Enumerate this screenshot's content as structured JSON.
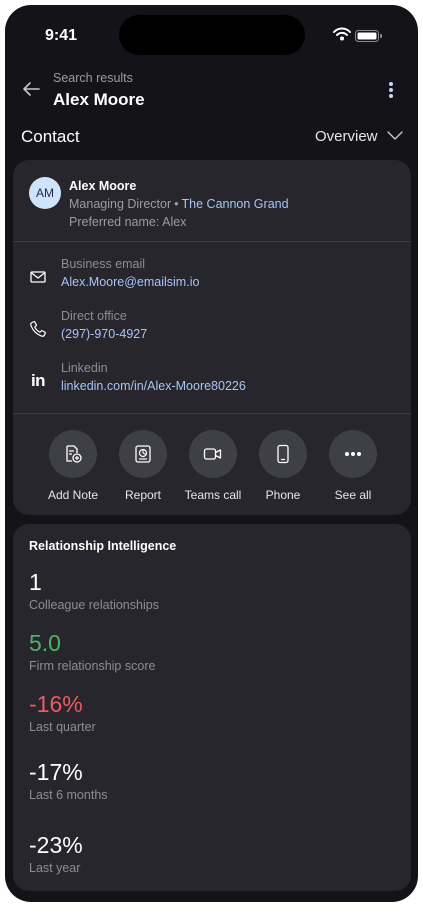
{
  "status_bar": {
    "time": "9:41"
  },
  "nav": {
    "subtitle": "Search results",
    "title": "Alex Moore"
  },
  "section": {
    "title": "Contact",
    "view_selector": "Overview"
  },
  "contact": {
    "initials": "AM",
    "name": "Alex Moore",
    "role": "Managing Director",
    "separator": "•",
    "company": "The Cannon Grand",
    "preferred_name": "Preferred name: Alex"
  },
  "details": {
    "email": {
      "label": "Business email",
      "value": "Alex.Moore@emailsim.io",
      "icon": "mail-icon"
    },
    "phone": {
      "label": "Direct office",
      "value": "(297)-970-4927",
      "icon": "phone-icon"
    },
    "linkedin": {
      "label": "Linkedin",
      "value": "linkedin.com/in/Alex-Moore80226",
      "icon": "linkedin-icon",
      "glyph": "in"
    }
  },
  "actions": [
    {
      "label": "Add Note",
      "icon": "add-note-icon"
    },
    {
      "label": "Report",
      "icon": "report-icon"
    },
    {
      "label": "Teams call",
      "icon": "video-call-icon"
    },
    {
      "label": "Phone",
      "icon": "mobile-phone-icon"
    },
    {
      "label": "See all",
      "icon": "more-icon"
    }
  ],
  "relationship_intelligence": {
    "title": "Relationship Intelligence",
    "metrics": [
      {
        "value": "1",
        "label": "Colleague relationships",
        "color": "#ffffff"
      },
      {
        "value": "5.0",
        "label": "Firm relationship score",
        "color": "#4cb562"
      },
      {
        "value": "-16%",
        "label": "Last quarter",
        "color": "#ee5a62"
      },
      {
        "value": "-17%",
        "label": "Last 6 months",
        "color": "#ffffff"
      },
      {
        "value": "-23%",
        "label": "Last year",
        "color": "#ffffff"
      }
    ]
  },
  "colors": {
    "background": "#141418",
    "card": "#26262c",
    "link": "#a9c4f5",
    "positive": "#4cb562",
    "negative": "#ee5a62",
    "avatar": "#cfe3fb"
  }
}
